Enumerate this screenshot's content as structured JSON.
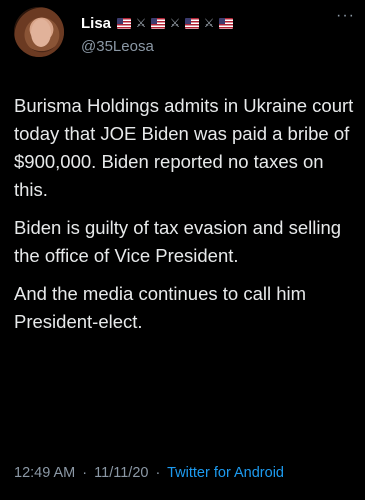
{
  "user": {
    "display_name": "Lisa",
    "handle": "@35Leosa",
    "name_emojis": [
      "flag-us",
      "crossed-swords",
      "flag-us",
      "crossed-swords",
      "flag-us",
      "crossed-swords",
      "flag-us"
    ]
  },
  "tweet": {
    "paragraphs": [
      "Burisma Holdings admits in Ukraine court today that JOE Biden was paid a bribe of $900,000. Biden reported no taxes on this.",
      "Biden is guilty of tax evasion and selling the office of Vice President.",
      "And the media continues to call him President-elect."
    ]
  },
  "meta": {
    "time": "12:49 AM",
    "date": "11/11/20",
    "separator": "·",
    "source": "Twitter for Android"
  },
  "icons": {
    "more": "more-options-icon"
  },
  "colors": {
    "background": "#000000",
    "text": "#e7e9ea",
    "secondary": "#8b98a5",
    "link": "#1d9bf0"
  }
}
